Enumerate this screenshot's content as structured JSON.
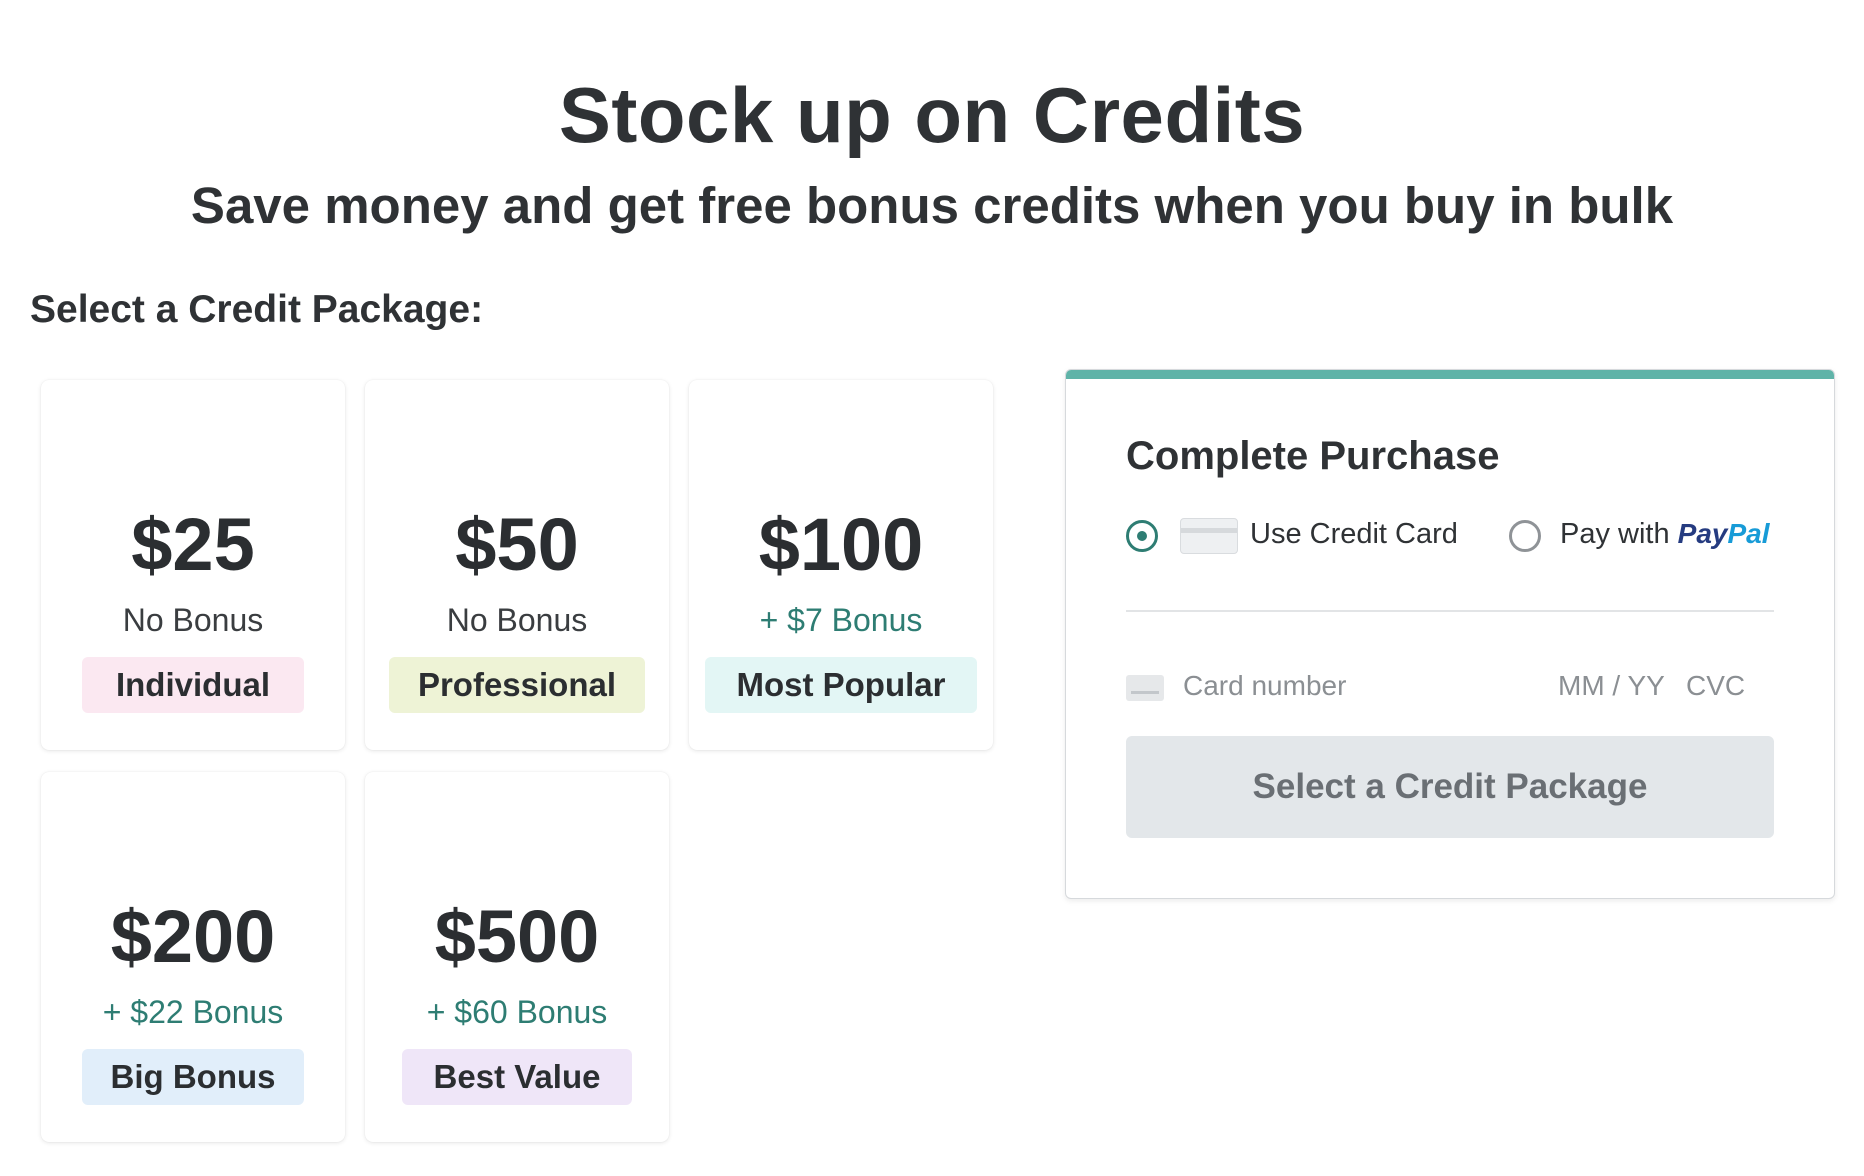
{
  "header": {
    "title": "Stock up on Credits",
    "subtitle": "Save money and get free bonus credits when you buy in bulk"
  },
  "packages_label": "Select a Credit Package:",
  "packages": [
    {
      "price": "$25",
      "bonus": "No Bonus",
      "tag": "Individual",
      "tag_color": "#fbe8f1"
    },
    {
      "price": "$50",
      "bonus": "No Bonus",
      "tag": "Professional",
      "tag_color": "#eef3d6"
    },
    {
      "price": "$100",
      "bonus": "+ $7 Bonus",
      "tag": "Most Popular",
      "tag_color": "#e3f6f5"
    },
    {
      "price": "$200",
      "bonus": "+ $22 Bonus",
      "tag": "Big Bonus",
      "tag_color": "#e1eefa"
    },
    {
      "price": "$500",
      "bonus": "+ $60 Bonus",
      "tag": "Best Value",
      "tag_color": "#efe6f8"
    }
  ],
  "purchase": {
    "title": "Complete Purchase",
    "credit_card_label": "Use Credit Card",
    "paypal_prefix": "Pay with",
    "paypal_brand_1": "Pay",
    "paypal_brand_2": "Pal",
    "selected_method": "credit_card",
    "card_number_placeholder": "Card number",
    "expiry_placeholder": "MM / YY",
    "cvc_placeholder": "CVC",
    "submit_label": "Select a Credit Package",
    "accent_color": "#5fb3a8"
  },
  "colors": {
    "bonus_green": "#2e7d73",
    "text_dark": "#2f3235"
  }
}
